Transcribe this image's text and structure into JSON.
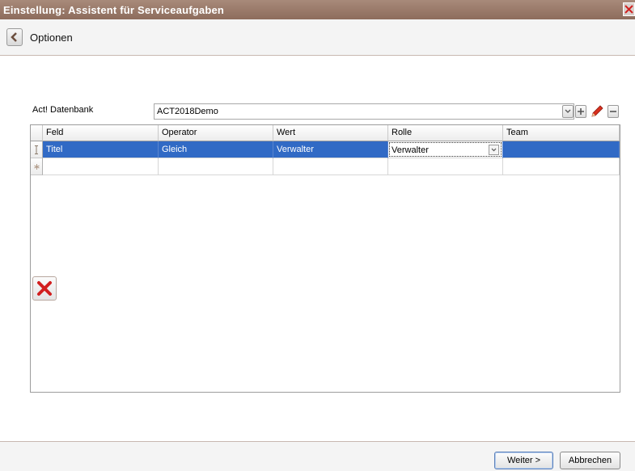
{
  "window": {
    "title": "Einstellung: Assistent für Serviceaufgaben"
  },
  "header": {
    "title": "Optionen"
  },
  "database": {
    "label": "Act! Datenbank",
    "value": "ACT2018Demo"
  },
  "grid": {
    "columns": [
      "Feld",
      "Operator",
      "Wert",
      "Rolle",
      "Team"
    ],
    "rows": [
      {
        "feld": "Titel",
        "operator": "Gleich",
        "wert": "Verwalter",
        "rolle": "Verwalter",
        "team": ""
      }
    ]
  },
  "buttons": {
    "next": "Weiter >",
    "cancel": "Abbrechen"
  },
  "colors": {
    "titlebar": "#8d6c5c",
    "selection": "#316ac5",
    "delete_icon": "#d21f1f",
    "edit_icon": "#d8301e"
  }
}
